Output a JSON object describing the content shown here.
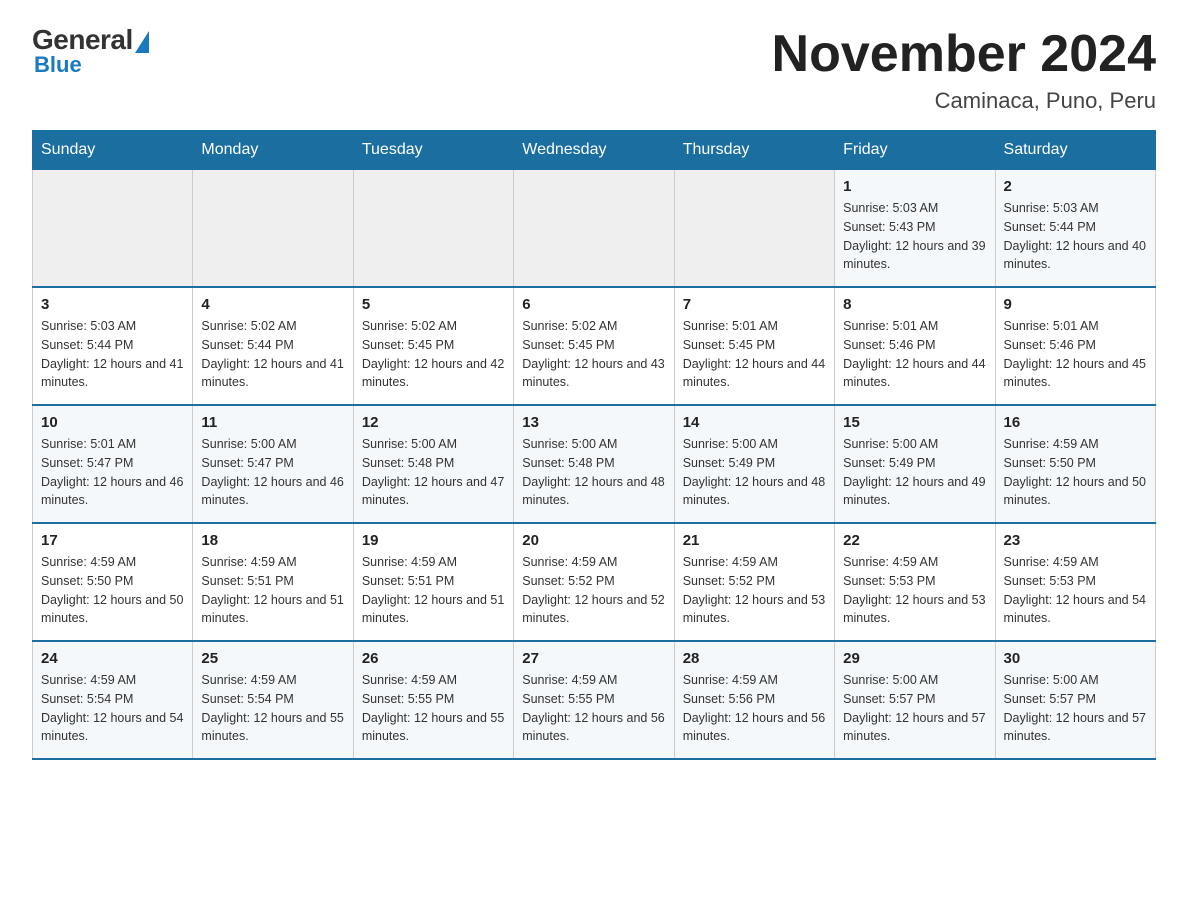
{
  "header": {
    "logo_general": "General",
    "logo_blue": "Blue",
    "title": "November 2024",
    "subtitle": "Caminaca, Puno, Peru"
  },
  "weekdays": [
    "Sunday",
    "Monday",
    "Tuesday",
    "Wednesday",
    "Thursday",
    "Friday",
    "Saturday"
  ],
  "weeks": [
    [
      {
        "day": "",
        "sunrise": "",
        "sunset": "",
        "daylight": ""
      },
      {
        "day": "",
        "sunrise": "",
        "sunset": "",
        "daylight": ""
      },
      {
        "day": "",
        "sunrise": "",
        "sunset": "",
        "daylight": ""
      },
      {
        "day": "",
        "sunrise": "",
        "sunset": "",
        "daylight": ""
      },
      {
        "day": "",
        "sunrise": "",
        "sunset": "",
        "daylight": ""
      },
      {
        "day": "1",
        "sunrise": "Sunrise: 5:03 AM",
        "sunset": "Sunset: 5:43 PM",
        "daylight": "Daylight: 12 hours and 39 minutes."
      },
      {
        "day": "2",
        "sunrise": "Sunrise: 5:03 AM",
        "sunset": "Sunset: 5:44 PM",
        "daylight": "Daylight: 12 hours and 40 minutes."
      }
    ],
    [
      {
        "day": "3",
        "sunrise": "Sunrise: 5:03 AM",
        "sunset": "Sunset: 5:44 PM",
        "daylight": "Daylight: 12 hours and 41 minutes."
      },
      {
        "day": "4",
        "sunrise": "Sunrise: 5:02 AM",
        "sunset": "Sunset: 5:44 PM",
        "daylight": "Daylight: 12 hours and 41 minutes."
      },
      {
        "day": "5",
        "sunrise": "Sunrise: 5:02 AM",
        "sunset": "Sunset: 5:45 PM",
        "daylight": "Daylight: 12 hours and 42 minutes."
      },
      {
        "day": "6",
        "sunrise": "Sunrise: 5:02 AM",
        "sunset": "Sunset: 5:45 PM",
        "daylight": "Daylight: 12 hours and 43 minutes."
      },
      {
        "day": "7",
        "sunrise": "Sunrise: 5:01 AM",
        "sunset": "Sunset: 5:45 PM",
        "daylight": "Daylight: 12 hours and 44 minutes."
      },
      {
        "day": "8",
        "sunrise": "Sunrise: 5:01 AM",
        "sunset": "Sunset: 5:46 PM",
        "daylight": "Daylight: 12 hours and 44 minutes."
      },
      {
        "day": "9",
        "sunrise": "Sunrise: 5:01 AM",
        "sunset": "Sunset: 5:46 PM",
        "daylight": "Daylight: 12 hours and 45 minutes."
      }
    ],
    [
      {
        "day": "10",
        "sunrise": "Sunrise: 5:01 AM",
        "sunset": "Sunset: 5:47 PM",
        "daylight": "Daylight: 12 hours and 46 minutes."
      },
      {
        "day": "11",
        "sunrise": "Sunrise: 5:00 AM",
        "sunset": "Sunset: 5:47 PM",
        "daylight": "Daylight: 12 hours and 46 minutes."
      },
      {
        "day": "12",
        "sunrise": "Sunrise: 5:00 AM",
        "sunset": "Sunset: 5:48 PM",
        "daylight": "Daylight: 12 hours and 47 minutes."
      },
      {
        "day": "13",
        "sunrise": "Sunrise: 5:00 AM",
        "sunset": "Sunset: 5:48 PM",
        "daylight": "Daylight: 12 hours and 48 minutes."
      },
      {
        "day": "14",
        "sunrise": "Sunrise: 5:00 AM",
        "sunset": "Sunset: 5:49 PM",
        "daylight": "Daylight: 12 hours and 48 minutes."
      },
      {
        "day": "15",
        "sunrise": "Sunrise: 5:00 AM",
        "sunset": "Sunset: 5:49 PM",
        "daylight": "Daylight: 12 hours and 49 minutes."
      },
      {
        "day": "16",
        "sunrise": "Sunrise: 4:59 AM",
        "sunset": "Sunset: 5:50 PM",
        "daylight": "Daylight: 12 hours and 50 minutes."
      }
    ],
    [
      {
        "day": "17",
        "sunrise": "Sunrise: 4:59 AM",
        "sunset": "Sunset: 5:50 PM",
        "daylight": "Daylight: 12 hours and 50 minutes."
      },
      {
        "day": "18",
        "sunrise": "Sunrise: 4:59 AM",
        "sunset": "Sunset: 5:51 PM",
        "daylight": "Daylight: 12 hours and 51 minutes."
      },
      {
        "day": "19",
        "sunrise": "Sunrise: 4:59 AM",
        "sunset": "Sunset: 5:51 PM",
        "daylight": "Daylight: 12 hours and 51 minutes."
      },
      {
        "day": "20",
        "sunrise": "Sunrise: 4:59 AM",
        "sunset": "Sunset: 5:52 PM",
        "daylight": "Daylight: 12 hours and 52 minutes."
      },
      {
        "day": "21",
        "sunrise": "Sunrise: 4:59 AM",
        "sunset": "Sunset: 5:52 PM",
        "daylight": "Daylight: 12 hours and 53 minutes."
      },
      {
        "day": "22",
        "sunrise": "Sunrise: 4:59 AM",
        "sunset": "Sunset: 5:53 PM",
        "daylight": "Daylight: 12 hours and 53 minutes."
      },
      {
        "day": "23",
        "sunrise": "Sunrise: 4:59 AM",
        "sunset": "Sunset: 5:53 PM",
        "daylight": "Daylight: 12 hours and 54 minutes."
      }
    ],
    [
      {
        "day": "24",
        "sunrise": "Sunrise: 4:59 AM",
        "sunset": "Sunset: 5:54 PM",
        "daylight": "Daylight: 12 hours and 54 minutes."
      },
      {
        "day": "25",
        "sunrise": "Sunrise: 4:59 AM",
        "sunset": "Sunset: 5:54 PM",
        "daylight": "Daylight: 12 hours and 55 minutes."
      },
      {
        "day": "26",
        "sunrise": "Sunrise: 4:59 AM",
        "sunset": "Sunset: 5:55 PM",
        "daylight": "Daylight: 12 hours and 55 minutes."
      },
      {
        "day": "27",
        "sunrise": "Sunrise: 4:59 AM",
        "sunset": "Sunset: 5:55 PM",
        "daylight": "Daylight: 12 hours and 56 minutes."
      },
      {
        "day": "28",
        "sunrise": "Sunrise: 4:59 AM",
        "sunset": "Sunset: 5:56 PM",
        "daylight": "Daylight: 12 hours and 56 minutes."
      },
      {
        "day": "29",
        "sunrise": "Sunrise: 5:00 AM",
        "sunset": "Sunset: 5:57 PM",
        "daylight": "Daylight: 12 hours and 57 minutes."
      },
      {
        "day": "30",
        "sunrise": "Sunrise: 5:00 AM",
        "sunset": "Sunset: 5:57 PM",
        "daylight": "Daylight: 12 hours and 57 minutes."
      }
    ]
  ]
}
